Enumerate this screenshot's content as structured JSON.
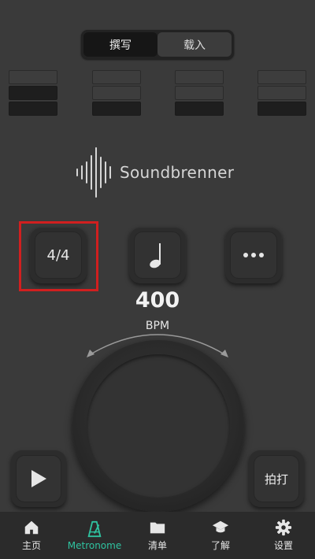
{
  "segment": {
    "write_label": "撰写",
    "load_label": "载入"
  },
  "beats": [
    {
      "levels": [
        "off",
        "on",
        "on"
      ]
    },
    {
      "levels": [
        "off",
        "off",
        "on"
      ]
    },
    {
      "levels": [
        "off",
        "off",
        "on"
      ]
    },
    {
      "levels": [
        "off",
        "off",
        "on"
      ]
    }
  ],
  "logo": {
    "text": "Soundbrenner"
  },
  "controls": {
    "time_signature": "4/4",
    "note_icon": "quarter-note-icon",
    "more_icon": "more-icon"
  },
  "tempo": {
    "value": "400",
    "unit": "BPM"
  },
  "buttons": {
    "tap_label": "拍打",
    "play_icon": "play-icon"
  },
  "tabs": [
    {
      "label": "主页",
      "icon": "home-icon",
      "active": false
    },
    {
      "label": "Metronome",
      "icon": "metronome-icon",
      "active": true
    },
    {
      "label": "清单",
      "icon": "folder-icon",
      "active": false
    },
    {
      "label": "了解",
      "icon": "graduation-cap-icon",
      "active": false
    },
    {
      "label": "设置",
      "icon": "gear-icon",
      "active": false
    }
  ],
  "colors": {
    "accent": "#2fc3a0",
    "highlight": "#d11f1f",
    "background": "#3a3a3a"
  }
}
